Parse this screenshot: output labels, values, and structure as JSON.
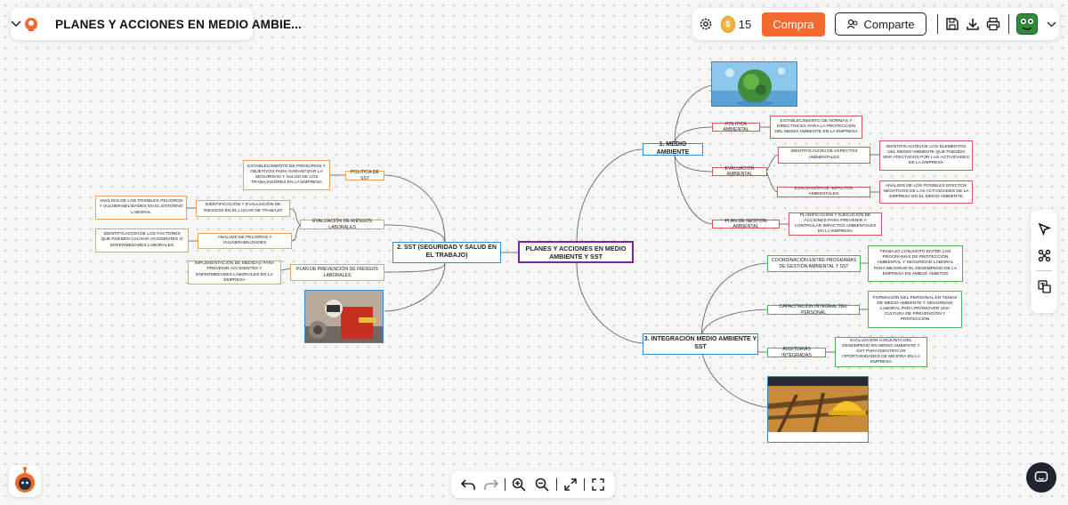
{
  "header": {
    "title": "PLANES Y ACCIONES EN MEDIO AMBIE...",
    "coins": "15",
    "buy_label": "Compra",
    "share_label": "Comparte"
  },
  "icons": {
    "menu": "chevron-down-icon",
    "logo": "app-logo",
    "settings": "gear-icon",
    "coin": "coin-icon",
    "save": "save-icon",
    "download": "download-icon",
    "print": "print-icon",
    "avatar": "user-avatar",
    "account_menu": "chevron-down-icon",
    "select": "cursor-icon",
    "connect": "command-icon",
    "translate": "translate-icon",
    "undo": "undo-icon",
    "redo": "redo-icon",
    "zoom_in": "zoom-in-icon",
    "zoom_out": "zoom-out-icon",
    "expand": "expand-icon",
    "fullscreen": "fullscreen-icon",
    "chat": "chat-icon"
  },
  "colors": {
    "root_border": "#8a1ea8",
    "main_border": "#2c8fd6",
    "env_branch": "#e15454",
    "sst_branch": "#f2a24d",
    "integration_branch": "#49b35a",
    "buy_button": "#f26a2e"
  },
  "mindmap": {
    "root": "PLANES Y ACCIONES EN MEDIO AMBIENTE Y SST",
    "main": {
      "env": "1. MEDIO AMBIENTE",
      "sst": "2. SST (SEGURIDAD Y SALUD EN EL TRABAJO)",
      "integration": "3. INTEGRACIÓN MEDIO AMBIENTE Y SST"
    },
    "env": {
      "policy": "POLITICA AMBIENTAL",
      "policy_detail": "ESTABLECIMIENTO DE NORMAS Y DIRECTRICES PARA LA PROTECCIÓN DEL MEDIO AMBIENTE EN LA EMPRESA",
      "evaluation": "EVALUACIÓN AMBIENTAL",
      "aspects": "IDENTIFICACIÓN DE ASPECTOS AMBIENTALES",
      "aspects_detail": "IDENTIFICACIÓN DE LOS ELEMENTOS DEL MEDIO AMBIENTE QUE PUEDEN SER AFECTADOS POR LAS ACTIVIDADES DE LA EMPRESA",
      "impacts": "EVALUACIÓN DE IMPACTOS AMBIENTALES",
      "impacts_detail": "ANÁLISIS DE LOS POSIBLES EFECTOS NEGATIVOS DE LAS ACTIVIDADES DE LA EMPRESA EN EL MEDIO AMBIENTE",
      "plan": "PLAN DE GESTIÓN AMBIENTAL",
      "plan_detail": "PLANIFICACIÓN Y EJECUCIÓN DE ACCIONES PARA PREVENIR Y CONTROLAR IMPACTOS AMBIENTALES EN LA EMPRESA"
    },
    "sst": {
      "policy": "POLITICA DE SST",
      "policy_detail": "ESTABLECIMIENTO DE PRINCIPIOS Y OBJETIVOS PARA GARANTIZAR LA SEGURIDAD Y SALUD DE LOS TRABAJADORES EN LA EMPRESA",
      "risk_eval": "EVALUACIÓN DE RIESGOS LABORALES",
      "hazard_id": "IDENTIFICACIÓN Y EVALUACIÓN DE RIESGOS EN EL LUGAR DE TRABAJO",
      "hazard_id_detail": "ANÁLISIS DE LOS POSIBLES PELIGROS Y VULNERABILIDADES EN EL ENTORNO LABORAL",
      "hazard_analysis": "ANÁLISIS DE PELIGROS Y VULNERABILIDADES",
      "hazard_analysis_detail": "IDENTIFICACIÓN DE LOS FACTORES QUE PUEDEN CAUSAR ACCIDENTES O ENFERMEDADES LABORALES",
      "prevention": "PLAN DE PREVENCIÓN DE RIESGOS LABORALES",
      "prevention_detail": "IMPLEMENTACIÓN DE MEDIDAS PARA PREVENIR ACCIDENTES Y ENFERMEDADES LABORALES EN LA EMPRESA"
    },
    "integration": {
      "coordination": "COORDINACIÓN ENTRE PROGRAMAS DE GESTIÓN AMBIENTAL Y SST",
      "coordination_detail": "TRABAJO CONJUNTO ENTRE LOS PROGRAMAS DE PROTECCIÓN AMBIENTAL Y SEGURIDAD LABORAL PARA MEJORAR EL DESEMPEÑO DE LA EMPRESA EN AMBOS ÁMBITOS",
      "training": "CAPACITACIÓN INTEGRAL DEL PERSONAL",
      "training_detail": "FORMACIÓN DEL PERSONAL EN TEMAS DE MEDIO AMBIENTE Y SEGURIDAD LABORAL PARA PROMOVER UNA CULTURA DE PREVENCIÓN Y PROTECCIÓN",
      "audits": "AUDITORÍAS INTEGRADAS",
      "audits_detail": "EVALUACIÓN CONJUNTA DEL DESEMPEÑO EN MEDIO AMBIENTE Y SST PARA IDENTIFICAR OPORTUNIDADES DE MEJORA EN LA EMPRESA"
    }
  }
}
